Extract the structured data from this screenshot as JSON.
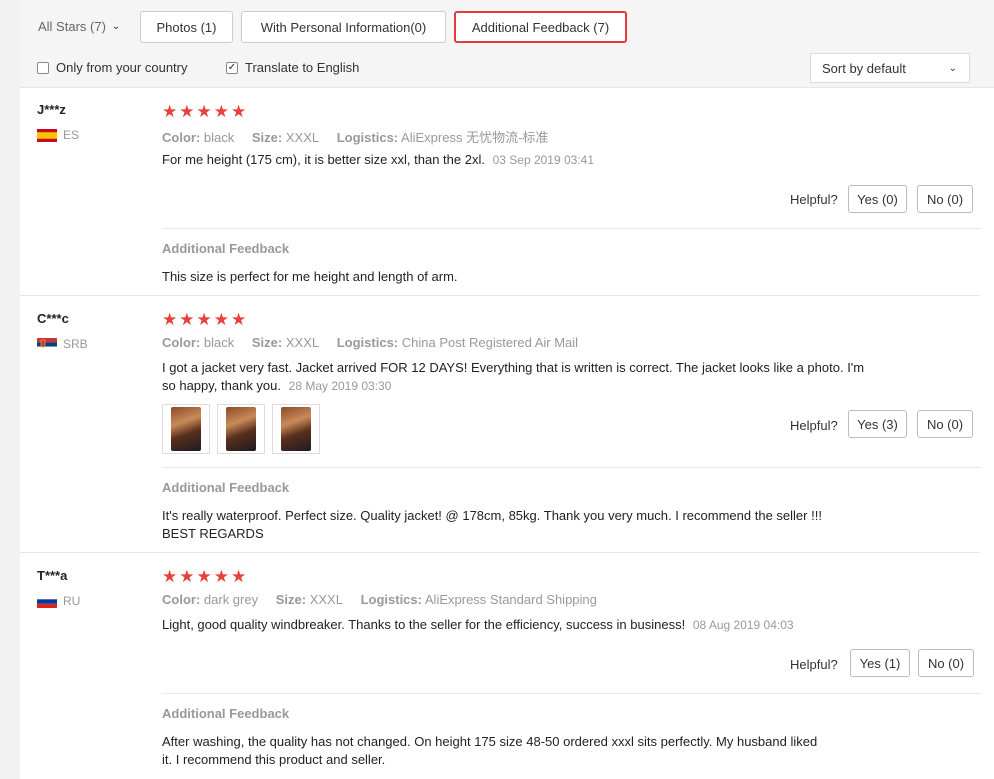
{
  "filters": {
    "all_stars": "All Stars (7)",
    "tabs": [
      {
        "label": "Photos (1)",
        "active": false
      },
      {
        "label": "With Personal Information(0)",
        "active": false
      },
      {
        "label": "Additional Feedback (7)",
        "active": true
      }
    ],
    "only_country": {
      "label": "Only from your country",
      "checked": false
    },
    "translate": {
      "label": "Translate to English",
      "checked": true
    },
    "sort": {
      "label": "Sort by default"
    }
  },
  "labels": {
    "color": "Color:",
    "size": "Size:",
    "logistics": "Logistics:",
    "helpful": "Helpful?",
    "additional_feedback": "Additional Feedback"
  },
  "colors": {
    "star": "#e8413b",
    "active_tab_border": "#e03c3c"
  },
  "reviews": [
    {
      "user": "J***z",
      "country": "ES",
      "flag": "spain-flag",
      "rating": 5,
      "color": "black",
      "size": "XXXL",
      "logistics": "AliExpress 无忧物流-标准",
      "text": "For me height (175 cm), it is better size xxl, than the 2xl.",
      "date": "03 Sep 2019 03:41",
      "yes": "Yes (0)",
      "no": "No (0)",
      "additional_text": "This size is perfect for me height and length of arm."
    },
    {
      "user": "C***c",
      "country": "SRB",
      "flag": "serbia-flag",
      "rating": 5,
      "color": "black",
      "size": "XXXL",
      "logistics": "China Post Registered Air Mail",
      "text_line1": "I got a jacket very fast. Jacket arrived FOR 12 DAYS! Everything that is written is correct. The jacket looks like a photo. I'm",
      "text_line2": "so happy, thank you.",
      "date": "28 May 2019 03:30",
      "photos": 3,
      "yes": "Yes (3)",
      "no": "No (0)",
      "additional_line1": "It's really waterproof. Perfect size. Quality jacket! @ 178cm, 85kg. Thank you very much. I recommend the seller !!!",
      "additional_line2": "BEST REGARDS"
    },
    {
      "user": "T***a",
      "country": "RU",
      "flag": "russia-flag",
      "rating": 5,
      "color": "dark grey",
      "size": "XXXL",
      "logistics": "AliExpress Standard Shipping",
      "text": "Light, good quality windbreaker. Thanks to the seller for the efficiency, success in business!",
      "date": "08 Aug 2019 04:03",
      "yes": "Yes (1)",
      "no": "No (0)",
      "additional_line1": "After washing, the quality has not changed. On height 175 size 48-50 ordered xxxl sits perfectly. My husband liked",
      "additional_line2": "it. I recommend this product and seller."
    }
  ]
}
